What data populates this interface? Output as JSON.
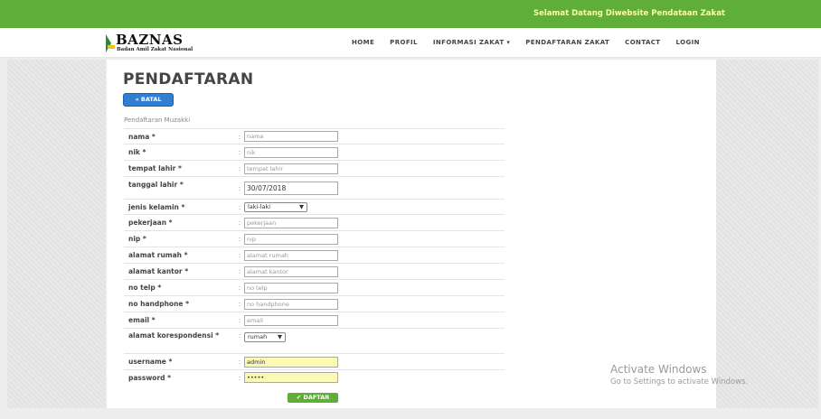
{
  "topbar": {
    "welcome": "Selamat Datang Diwebsite Pendataan Zakat"
  },
  "brand": {
    "title": "BAZNAS",
    "subtitle": "Badan Amil Zakat Nasional"
  },
  "menu": [
    {
      "label": "HOME"
    },
    {
      "label": "PROFIL"
    },
    {
      "label": "INFORMASI ZAKAT ▾"
    },
    {
      "label": "PENDAFTARAN ZAKAT"
    },
    {
      "label": "CONTACT"
    },
    {
      "label": "LOGIN"
    }
  ],
  "page": {
    "title": "PENDAFTARAN",
    "batal": "« BATAL",
    "subtitle": "Pendaftaran Muzakki",
    "daftar": "✔ DAFTAR"
  },
  "form": [
    {
      "label": "nama *",
      "placeholder": "nama"
    },
    {
      "label": "nik *",
      "placeholder": "nik"
    },
    {
      "label": "tempat lahir *",
      "placeholder": "tempat lahir"
    },
    {
      "label": "tanggal lahir *",
      "value": "30/07/2018"
    },
    {
      "label": "jenis kelamin *",
      "select": "laki-laki"
    },
    {
      "label": "pekerjaan *",
      "placeholder": "pekerjaan"
    },
    {
      "label": "nip *",
      "placeholder": "nip"
    },
    {
      "label": "alamat rumah *",
      "placeholder": "alamat rumah"
    },
    {
      "label": "alamat kantor *",
      "placeholder": "alamat kantor"
    },
    {
      "label": "no telp *",
      "placeholder": "no telp"
    },
    {
      "label": "no handphone *",
      "placeholder": "no handphone"
    },
    {
      "label": "email *",
      "placeholder": "email"
    },
    {
      "label": "alamat korespondensi *",
      "select": "rumah"
    },
    {
      "label": "username *",
      "value": "admin"
    },
    {
      "label": "password *",
      "value": "•••••"
    }
  ],
  "separator": ":",
  "watermark": {
    "line1": "Activate Windows",
    "line2": "Go to Settings to activate Windows."
  },
  "colors": {
    "green": "#5fae3a",
    "blue": "#2f7fd2",
    "autofill": "#fafab4"
  }
}
